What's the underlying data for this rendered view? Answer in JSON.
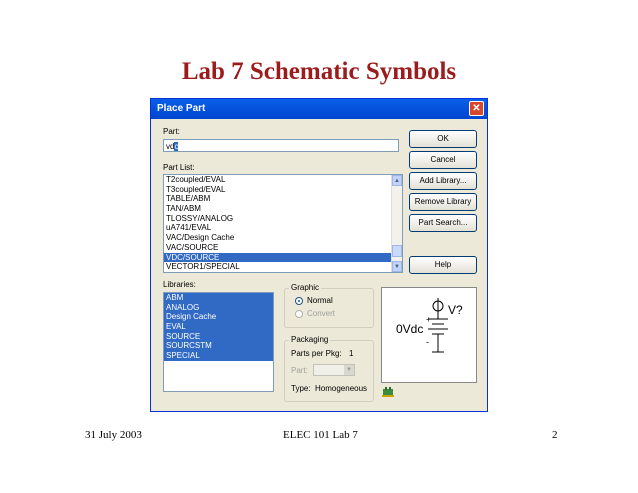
{
  "slide": {
    "title": "Lab 7 Schematic Symbols",
    "footer_left": "31 July 2003",
    "footer_center": "ELEC 101 Lab 7",
    "footer_right": "2"
  },
  "dialog": {
    "title": "Place Part",
    "part_label": "Part:",
    "part_value_prefix": "vd",
    "part_value_selected": "c",
    "part_list_label": "Part List:",
    "part_list": [
      "T2coupled/EVAL",
      "T3coupled/EVAL",
      "TABLE/ABM",
      "TAN/ABM",
      "TLOSSY/ANALOG",
      "uA741/EVAL",
      "VAC/Design Cache",
      "VAC/SOURCE",
      "VDC/SOURCE",
      "VECTOR1/SPECIAL"
    ],
    "part_list_selected": "VDC/SOURCE",
    "libraries_label": "Libraries:",
    "libraries": [
      "ABM",
      "ANALOG",
      "Design Cache",
      "EVAL",
      "SOURCE",
      "SOURCSTM",
      "SPECIAL"
    ],
    "buttons": {
      "ok": "OK",
      "cancel": "Cancel",
      "add_library": "Add Library...",
      "remove_library": "Remove Library",
      "part_search": "Part Search...",
      "help": "Help"
    },
    "graphic": {
      "legend": "Graphic",
      "normal": "Normal",
      "convert": "Convert",
      "selected": "Normal"
    },
    "packaging": {
      "legend": "Packaging",
      "parts_per_pkg_label": "Parts per Pkg:",
      "parts_per_pkg_value": "1",
      "part_label": "Part:",
      "type_label": "Type:",
      "type_value": "Homogeneous"
    },
    "preview": {
      "ref_label": "V?",
      "value_label": "0Vdc",
      "plus": "+",
      "minus": "-"
    },
    "colors": {
      "selection": "#316ac5",
      "titlebar": "#0054e3",
      "close": "#d9462c",
      "title_text": "#9b1c1c"
    }
  }
}
